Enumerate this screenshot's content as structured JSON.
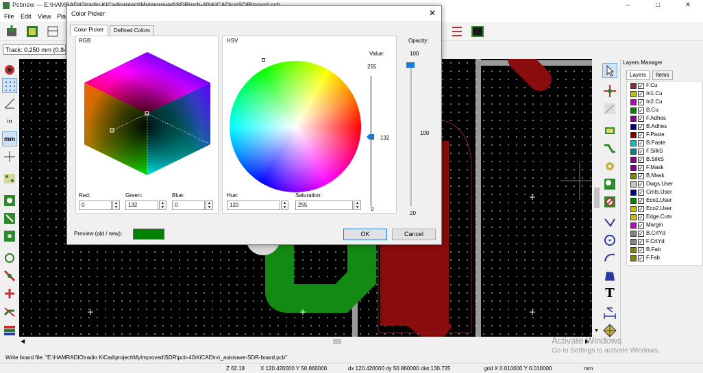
{
  "window": {
    "title": "Pcbnew — E:\\HAMRADIO\\radio KiCad\\project\\Myimproved\\SDR\\pcb-40\\KiCAD\\rx\\SDR\\board.pcb"
  },
  "menu": [
    "File",
    "Edit",
    "View",
    "Pla"
  ],
  "toolbar": {
    "track_width": "Track: 0.250 mm (0.84"
  },
  "dialog": {
    "title": "Color Picker",
    "tabs": [
      "Color Picker",
      "Defined Colors"
    ],
    "rgb_label": "RGB",
    "hsv_label": "HSV",
    "value_label": "Value:",
    "value_top": "255",
    "value_current": "132",
    "value_bottom": "0",
    "opacity_label": "Opacity:",
    "opacity_top": "100",
    "opacity_current": "100",
    "opacity_bottom": "20",
    "fields": {
      "red_label": "Red:",
      "red": "0",
      "green_label": "Green:",
      "green": "132",
      "blue_label": "Blue:",
      "blue": "0",
      "hue_label": "Hue:",
      "hue": "120",
      "sat_label": "Saturation:",
      "sat": "255"
    },
    "preview_label": "Preview (old / new):",
    "preview_color": "#008400",
    "ok": "OK",
    "cancel": "Cancel"
  },
  "layers_manager": {
    "title": "Layers Manager",
    "tabs": [
      "Layers",
      "Items"
    ],
    "layers": [
      {
        "name": "F.Cu",
        "color": "#843030"
      },
      {
        "name": "In1.Cu",
        "color": "#c2c200"
      },
      {
        "name": "In2.Cu",
        "color": "#c200c2"
      },
      {
        "name": "B.Cu",
        "color": "#008400"
      },
      {
        "name": "F.Adhes",
        "color": "#840084"
      },
      {
        "name": "B.Adhes",
        "color": "#000084"
      },
      {
        "name": "F.Paste",
        "color": "#840000"
      },
      {
        "name": "B.Paste",
        "color": "#00c2c2"
      },
      {
        "name": "F.SilkS",
        "color": "#008484"
      },
      {
        "name": "B.SilkS",
        "color": "#840084"
      },
      {
        "name": "F.Mask",
        "color": "#840084"
      },
      {
        "name": "B.Mask",
        "color": "#848400"
      },
      {
        "name": "Dwgs.User",
        "color": "#c2c2c2"
      },
      {
        "name": "Cmts.User",
        "color": "#000084"
      },
      {
        "name": "Eco1.User",
        "color": "#008400"
      },
      {
        "name": "Eco2.User",
        "color": "#c2c200"
      },
      {
        "name": "Edge.Cuts",
        "color": "#c2c200"
      },
      {
        "name": "Margin",
        "color": "#c200c2"
      },
      {
        "name": "B.CrtYd",
        "color": "#848484"
      },
      {
        "name": "F.CrtYd",
        "color": "#848484"
      },
      {
        "name": "B.Fab",
        "color": "#848400"
      },
      {
        "name": "F.Fab",
        "color": "#848400"
      }
    ]
  },
  "status": {
    "message": "Write board file: \"E:\\HAMRADIO\\radio KiCad\\project\\MyImproved\\SDR\\pcb-40\\KiCAD\\rx\\_autosave-SDR-board.pcb\"",
    "zoom": "Z 62.18",
    "xy": "X 120.420000 Y 50.860000",
    "dxy": "dx 120.420000 dy 50.860000 dist 130.725",
    "grid": "grid X 0.010000 Y 0.010000",
    "units": "mm"
  },
  "watermark": {
    "line1": "Activate Windows",
    "line2": "Go to Settings to activate Windows."
  }
}
